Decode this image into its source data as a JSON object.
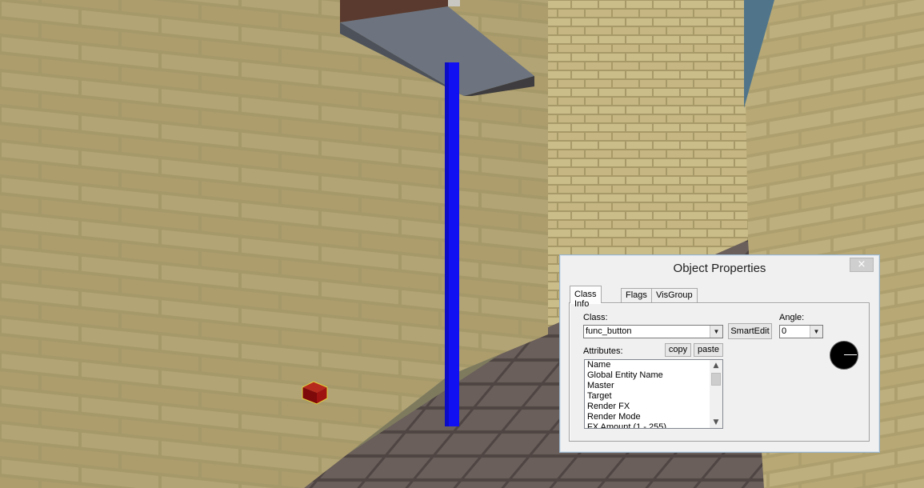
{
  "scene": {
    "colors": {
      "wall": "#b6a774",
      "mortar": "#8e8257",
      "floor": "#5b504c",
      "pillar": "#0e0ef0",
      "ledge": "#6e7580",
      "entity_box": "#8a0d0d"
    }
  },
  "dialog": {
    "title": "Object Properties",
    "close_icon": "×",
    "tabs": [
      {
        "label": "Class Info",
        "active": true
      },
      {
        "label": "Flags",
        "active": false
      },
      {
        "label": "VisGroup",
        "active": false
      }
    ],
    "class_label": "Class:",
    "class_value": "func_button",
    "smartedit_label": "SmartEdit",
    "angle_label": "Angle:",
    "angle_value": "0",
    "attributes_label": "Attributes:",
    "copy_label": "copy",
    "paste_label": "paste",
    "attributes": [
      "Name",
      "Global Entity Name",
      "Master",
      "Target",
      "Render FX",
      "Render Mode",
      "FX Amount (1 - 255)"
    ],
    "dropdown_icon": "▼",
    "scroll_up_icon": "▲",
    "scroll_down_icon": "▼"
  }
}
